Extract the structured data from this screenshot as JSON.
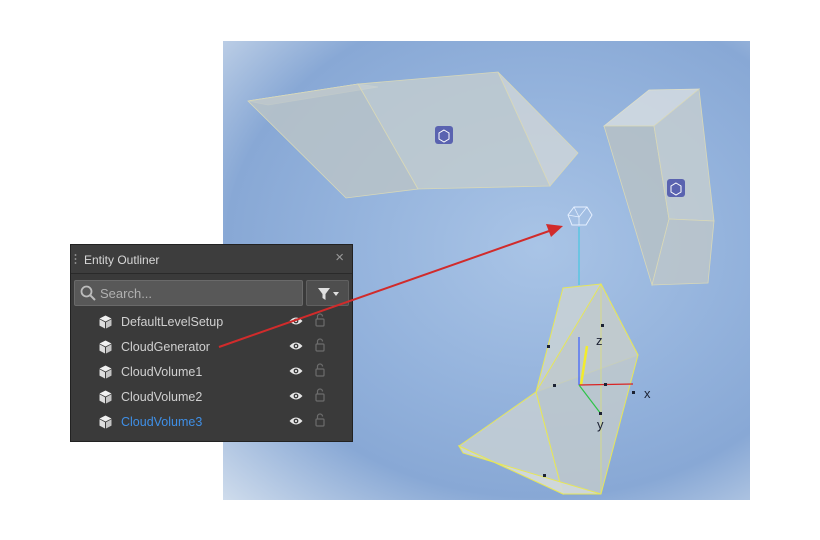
{
  "outliner": {
    "title": "Entity Outliner",
    "close_glyph": "×",
    "search": {
      "placeholder": "Search..."
    },
    "entities": [
      {
        "label": "DefaultLevelSetup",
        "icon": "cube-icon",
        "selected": false
      },
      {
        "label": "CloudGenerator",
        "icon": "cube-icon",
        "selected": false
      },
      {
        "label": "CloudVolume1",
        "icon": "cube-icon",
        "selected": false
      },
      {
        "label": "CloudVolume2",
        "icon": "cube-icon",
        "selected": false
      },
      {
        "label": "CloudVolume3",
        "icon": "cube-icon",
        "selected": true
      }
    ]
  },
  "viewport": {
    "gizmo_axes": {
      "x": "x",
      "y": "y",
      "z": "z"
    }
  },
  "colors": {
    "panel_bg": "#3a3a3a",
    "selected_text": "#3f8fe6",
    "annotation_arrow": "#d12b2b",
    "selection_outline": "#e6e65a",
    "volume_fill": "#c8d2d6"
  }
}
